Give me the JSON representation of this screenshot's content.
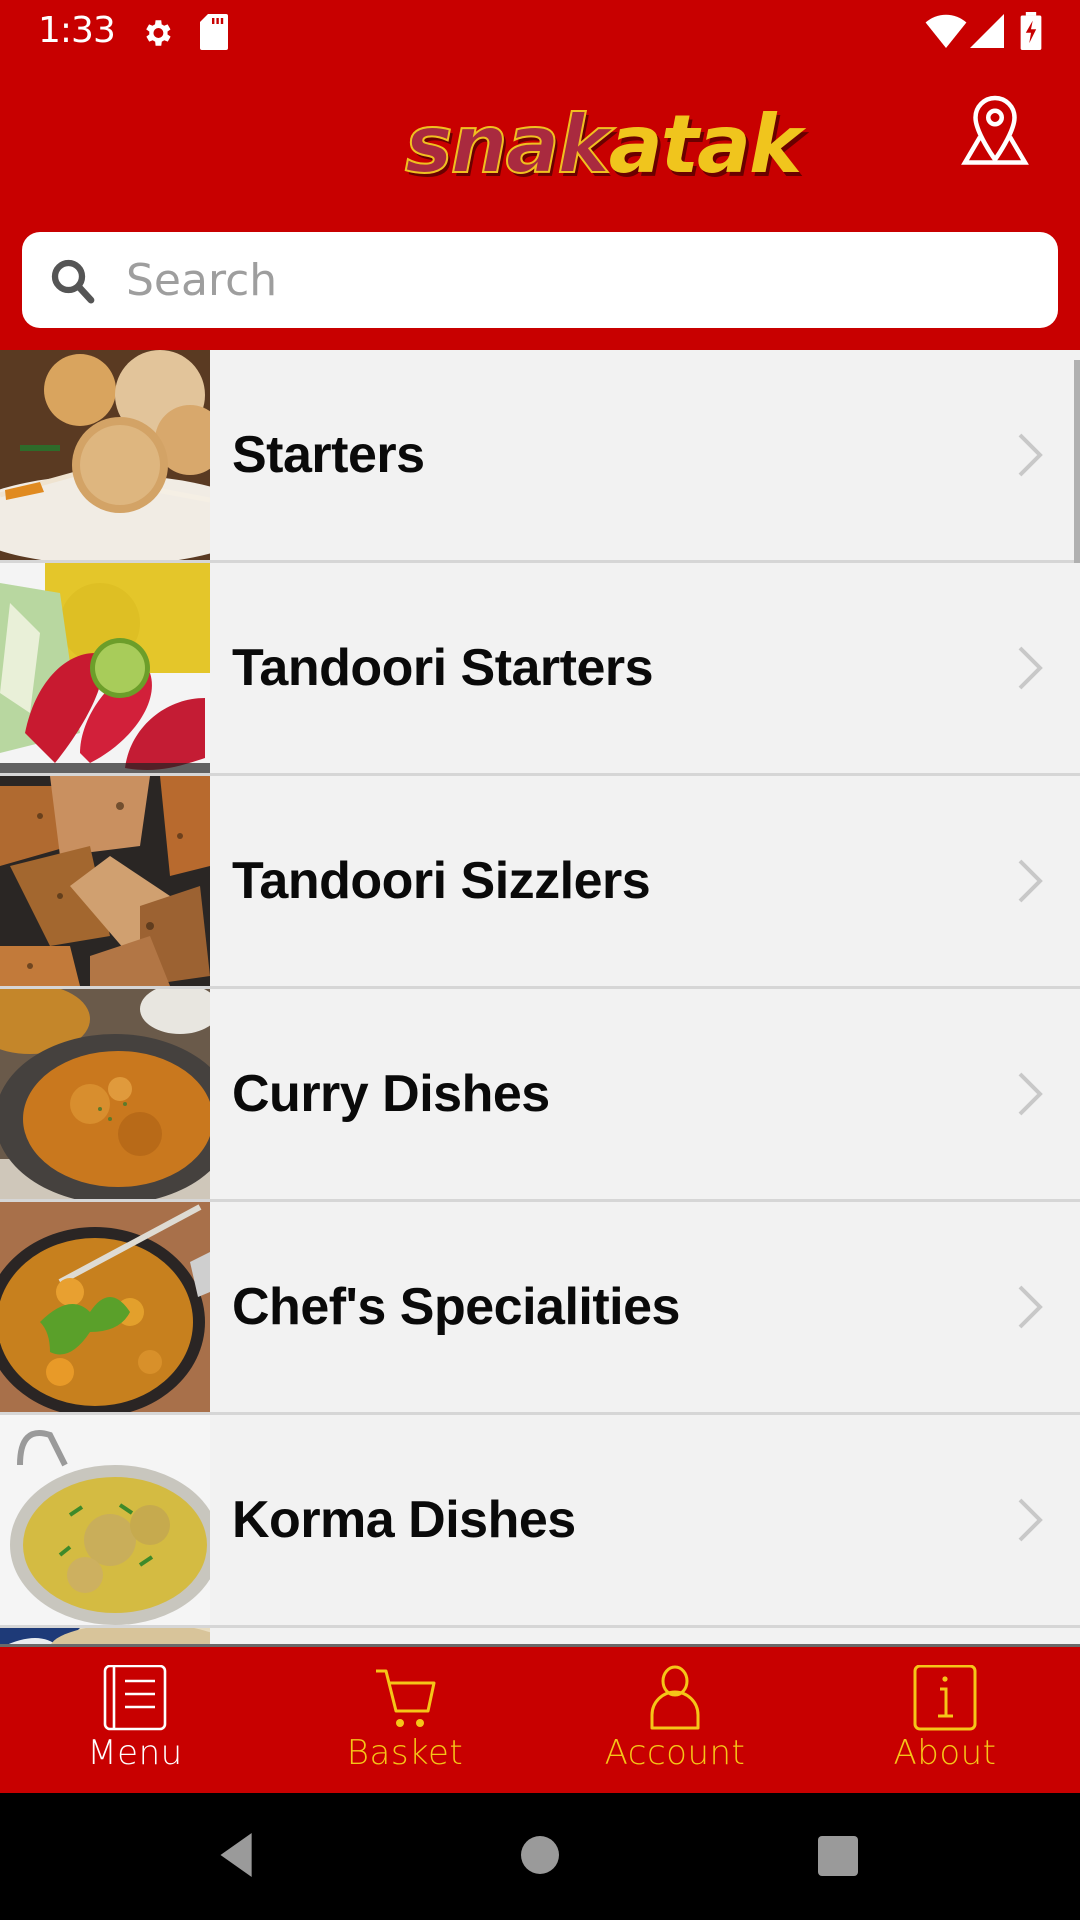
{
  "status_bar": {
    "time": "1:33",
    "left_icons": [
      "gear-icon",
      "sd-card-icon"
    ],
    "right_icons": [
      "wifi-icon",
      "cell-signal-icon",
      "battery-charging-icon"
    ]
  },
  "app_bar": {
    "logo_part1": "snak",
    "logo_part2": "atak",
    "location_button": "location-pin-icon"
  },
  "search": {
    "placeholder": "Search",
    "value": ""
  },
  "categories": [
    {
      "label": "Starters",
      "image": "fried-bites-on-sticks"
    },
    {
      "label": "Tandoori Starters",
      "image": "tandoori-chicken-rice-lime"
    },
    {
      "label": "Tandoori Sizzlers",
      "image": "grilled-chicken-wings"
    },
    {
      "label": "Curry Dishes",
      "image": "curry-in-dark-bowl"
    },
    {
      "label": "Chef's Specialities",
      "image": "vegetable-curry-with-coriander"
    },
    {
      "label": "Korma Dishes",
      "image": "korma-in-balti-dish"
    },
    {
      "label": "",
      "image": "naan-bread-partial"
    }
  ],
  "bottom_nav": [
    {
      "label": "Menu",
      "icon": "menu-book-icon",
      "active": true
    },
    {
      "label": "Basket",
      "icon": "cart-icon",
      "active": false
    },
    {
      "label": "Account",
      "icon": "person-icon",
      "active": false
    },
    {
      "label": "About",
      "icon": "info-icon",
      "active": false
    }
  ],
  "colors": {
    "brand_red": "#c80000",
    "accent_yellow": "#f5c518",
    "active_white": "#ffffff",
    "list_bg": "#f2f2f2",
    "divider": "#d6d6d6"
  }
}
